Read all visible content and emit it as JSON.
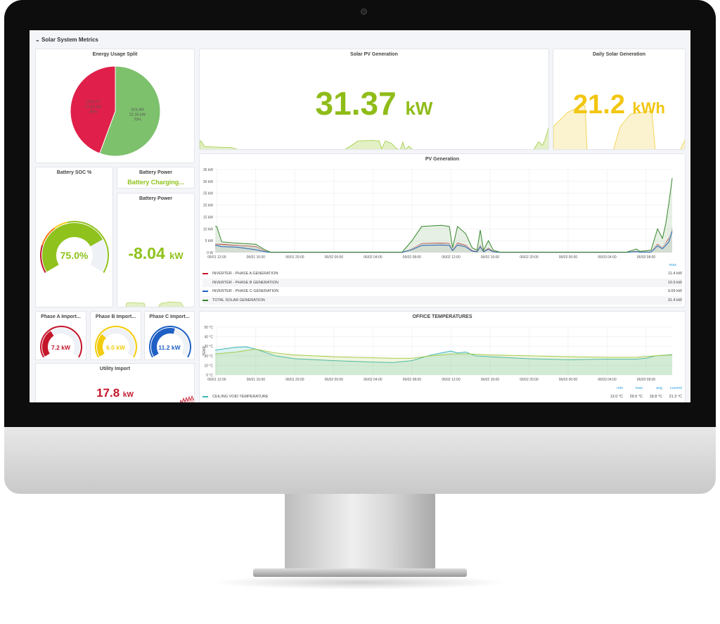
{
  "dashboard": {
    "row_title": "Solar System Metrics"
  },
  "energy_split": {
    "title": "Energy Usage Split",
    "slices": [
      {
        "label": "UTILITY",
        "value_text": "17.82 kW",
        "pct": "30%",
        "value": 17.82,
        "color": "#e0204a"
      },
      {
        "label": "SOLAR",
        "value_text": "22.36 kW",
        "pct": "70%",
        "value": 22.36,
        "color": "#7ec16d"
      }
    ]
  },
  "solar_pv": {
    "title": "Solar PV Generation",
    "value": "31.37",
    "unit": "kW",
    "color": "#8fbc18"
  },
  "daily_solar": {
    "title": "Daily Solar Generation",
    "value": "21.2",
    "unit": "kWh",
    "color": "#f2c611"
  },
  "battery_soc": {
    "title": "Battery SOC %",
    "value": "75.0%",
    "level": 75,
    "color": "#8fc21c"
  },
  "battery_status": {
    "title": "Battery Power",
    "value": "Battery Charging...",
    "color": "#8fc21c"
  },
  "battery_power": {
    "title": "Battery Power",
    "value": "-8.04",
    "unit": "kW",
    "color": "#8fc21c"
  },
  "phases": [
    {
      "title": "Phase A Import...",
      "value": "7.2 kW",
      "level": 0.36,
      "color": "#c4162a"
    },
    {
      "title": "Phase B Import...",
      "value": "6.0 kW",
      "level": 0.3,
      "color": "#f2cc0c"
    },
    {
      "title": "Phase C Import...",
      "value": "11.2 kW",
      "level": 0.56,
      "color": "#1f60c4"
    }
  ],
  "utility": {
    "title": "Utility Import",
    "value": "17.8",
    "unit": "kW",
    "color": "#c4162a"
  },
  "chart_data": [
    {
      "type": "line",
      "title": "PV Generation",
      "ylim": [
        0,
        35
      ],
      "yticks": [
        "0 W",
        "5 kW",
        "10 kW",
        "15 kW",
        "20 kW",
        "25 kW",
        "30 kW",
        "35 kW"
      ],
      "xticks": [
        "06/01 12:00",
        "06/01 16:00",
        "06/01 20:00",
        "06/02 00:00",
        "06/02 04:00",
        "06/02 08:00",
        "06/02 12:00",
        "06/02 16:00",
        "06/02 20:00",
        "06/03 00:00",
        "06/03 04:00",
        "06/03 08:00"
      ],
      "legend_header": "max",
      "grid": true,
      "x": [
        "06/01 11:50",
        "06/01 12:00",
        "06/01 12:30",
        "06/01 14:00",
        "06/01 16:00",
        "06/01 17:00",
        "06/01 17:30",
        "06/02 07:00",
        "06/02 08:00",
        "06/02 09:00",
        "06/02 11:00",
        "06/02 11:50",
        "06/02 12:10",
        "06/02 12:40",
        "06/02 13:30",
        "06/02 14:10",
        "06/02 14:40",
        "06/02 15:00",
        "06/02 15:20",
        "06/02 15:50",
        "06/02 16:20",
        "06/02 17:00",
        "06/03 06:00",
        "06/03 07:00",
        "06/03 07:20",
        "06/03 08:30",
        "06/03 09:10",
        "06/03 09:40",
        "06/03 10:00",
        "06/03 10:20",
        "06/03 10:40"
      ],
      "series": [
        {
          "name": "INVERTER - PHASE A GENERATION",
          "max": "11.4 kW",
          "color": "#c4162a",
          "values": [
            3.5,
            3.5,
            3.5,
            3,
            2.5,
            0.5,
            0.1,
            0.1,
            1.5,
            3.8,
            4,
            3.8,
            1,
            4,
            3,
            0.8,
            0.4,
            3,
            0.4,
            1.8,
            0.4,
            0.1,
            0.1,
            0.5,
            0.2,
            0.3,
            3.5,
            2,
            4,
            6,
            10
          ]
        },
        {
          "name": "INVERTER - PHASE B GENERATION",
          "max": "10.9 kW",
          "color": "#e8e8e8",
          "values": [
            3.3,
            3.3,
            3.2,
            2.8,
            2.3,
            0.4,
            0.1,
            0.1,
            1.4,
            3.6,
            3.8,
            3.6,
            0.9,
            3.8,
            2.8,
            0.7,
            0.3,
            2.8,
            0.3,
            1.6,
            0.3,
            0.1,
            0.1,
            0.4,
            0.2,
            0.3,
            3.3,
            1.9,
            3.8,
            5.6,
            10.9
          ]
        },
        {
          "name": "INVERTER - PHASE C GENERATION",
          "max": "9.09 kW",
          "color": "#1f60c4",
          "values": [
            3,
            3,
            2.5,
            2.3,
            1.2,
            0.3,
            0.1,
            0.1,
            1.2,
            3,
            3.2,
            3,
            0.8,
            3.2,
            2.4,
            0.6,
            0.3,
            2.4,
            0.3,
            1.4,
            0.3,
            0.1,
            0.1,
            0.4,
            0.2,
            0.2,
            2.8,
            1.6,
            3,
            4.5,
            9
          ]
        },
        {
          "name": "TOTAL SOLAR GENERATION",
          "max": "31.4 kW",
          "color": "#37872d",
          "values": [
            11,
            11,
            4.5,
            4,
            3.5,
            1,
            0.2,
            0.2,
            5,
            11,
            11.5,
            11,
            2,
            11,
            8,
            2,
            1,
            9.5,
            1,
            5,
            1,
            0.2,
            0.2,
            1.5,
            0.5,
            1,
            10,
            6,
            12,
            21,
            31.4
          ]
        }
      ]
    },
    {
      "type": "area",
      "title": "OFFICE TEMPERATURES",
      "ylabel": "TEMP",
      "ylim": [
        0,
        50
      ],
      "yticks": [
        "0 °C",
        "10 °C",
        "20 °C",
        "30 °C",
        "40 °C",
        "50 °C"
      ],
      "xticks": [
        "06/01 12:00",
        "06/01 16:00",
        "06/01 20:00",
        "06/02 00:00",
        "06/02 04:00",
        "06/02 08:00",
        "06/02 12:00",
        "06/02 16:00",
        "06/02 20:00",
        "06/03 00:00",
        "06/03 04:00",
        "06/03 08:00"
      ],
      "legend_headers": [
        "min",
        "max",
        "avg",
        "current"
      ],
      "grid": true,
      "series": [
        {
          "name": "CEILING VOID TEMPERATURE",
          "color": "#3fb5b5",
          "min": "13.0 °C",
          "max": "29.5 °C",
          "avg": "18.8 °C",
          "current": "21.3 °C",
          "x": [
            "06/01 11:50",
            "06/01 14:00",
            "06/01 15:00",
            "06/01 16:00",
            "06/01 18:00",
            "06/01 20:00",
            "06/02 00:00",
            "06/02 04:00",
            "06/02 06:00",
            "06/02 08:00",
            "06/02 10:00",
            "06/02 12:00",
            "06/02 12:40",
            "06/02 13:30",
            "06/02 14:30",
            "06/02 16:00",
            "06/02 20:00",
            "06/03 00:00",
            "06/03 04:00",
            "06/03 07:00",
            "06/03 08:00",
            "06/03 09:00",
            "06/03 10:40"
          ],
          "values": [
            26,
            29,
            29.5,
            27,
            20,
            17,
            15,
            13.5,
            13,
            15,
            21,
            25,
            23,
            24,
            20,
            19,
            17,
            16,
            16.5,
            16.5,
            17.5,
            20,
            21.3
          ]
        },
        {
          "color": "#a6cc4c",
          "x": [
            "06/01 11:50",
            "06/01 14:00",
            "06/01 16:00",
            "06/01 18:00",
            "06/01 20:00",
            "06/02 00:00",
            "06/02 04:00",
            "06/02 06:00",
            "06/02 08:00",
            "06/02 10:00",
            "06/02 12:00",
            "06/02 14:00",
            "06/02 16:00",
            "06/02 20:00",
            "06/03 00:00",
            "06/03 04:00",
            "06/03 07:00",
            "06/03 09:00",
            "06/03 10:40"
          ],
          "values": [
            22,
            24,
            27,
            23,
            21,
            19,
            18,
            17.5,
            17.5,
            20,
            22,
            22,
            21,
            20,
            19,
            18.5,
            18.5,
            20,
            21
          ]
        }
      ]
    }
  ]
}
